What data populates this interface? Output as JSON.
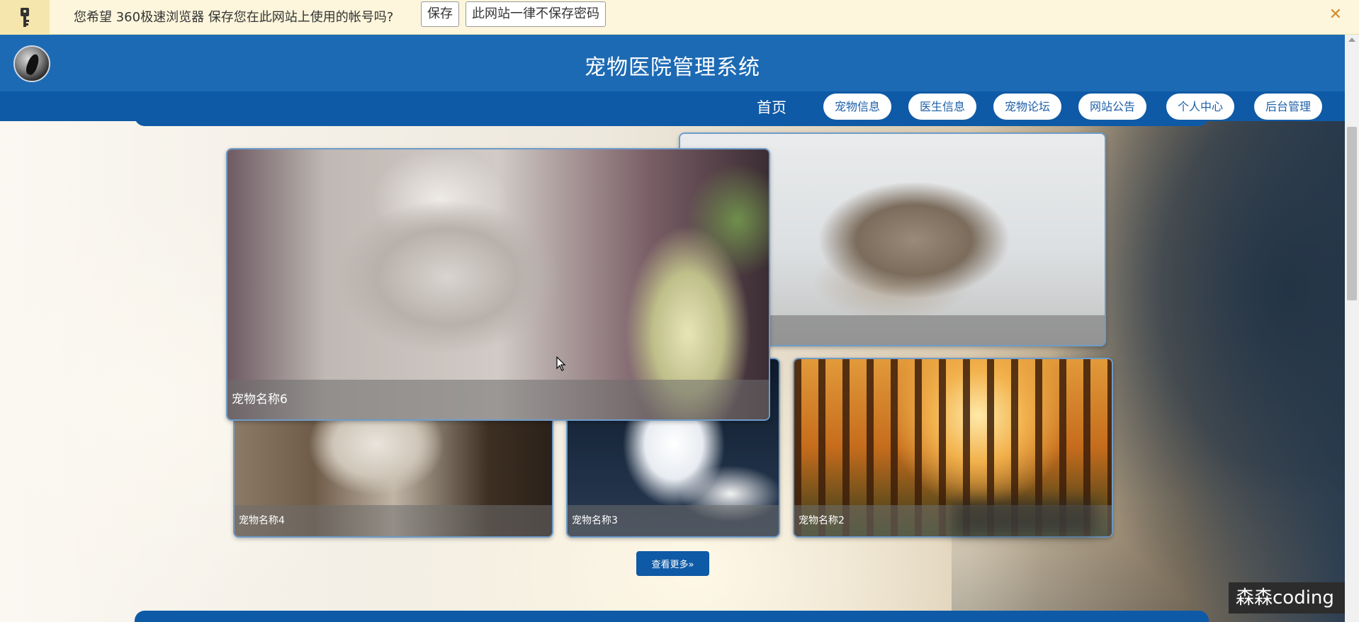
{
  "password_bar": {
    "message": "您希望 360极速浏览器 保存您在此网站上使用的帐号吗?",
    "save_label": "保存",
    "never_label": "此网站一律不保存密码",
    "close_glyph": "✕"
  },
  "header": {
    "title": "宠物医院管理系统"
  },
  "nav": {
    "home": "首页",
    "items": [
      "宠物信息",
      "医生信息",
      "宠物论坛",
      "网站公告",
      "个人中心",
      "后台管理"
    ]
  },
  "pets": [
    {
      "name": "宠物名称6"
    },
    {
      "name": ""
    },
    {
      "name": "宠物名称4"
    },
    {
      "name": "宠物名称3"
    },
    {
      "name": "宠物名称2"
    }
  ],
  "more_button": "查看更多»",
  "watermark": "森森coding",
  "colors": {
    "header": "#1d6ab4",
    "nav": "#0f5aa6",
    "pill_text": "#1d5fa8",
    "card_border": "#6e9cc9"
  }
}
